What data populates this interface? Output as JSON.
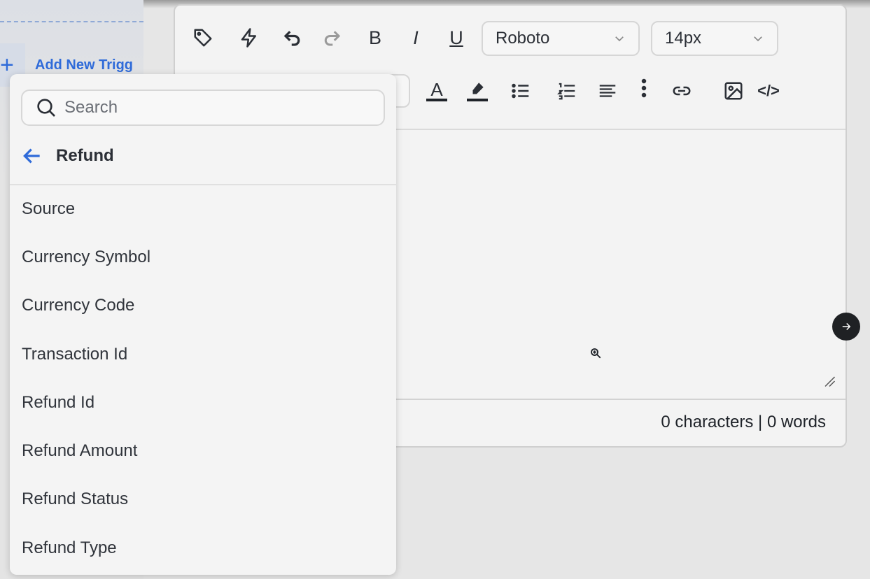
{
  "background": {
    "add_trigger_label": "Add New Trigg",
    "plus_symbol": "+"
  },
  "toolbar": {
    "icons": [
      "tag-icon",
      "bolt-icon",
      "undo-icon",
      "redo-icon",
      "bold-icon",
      "italic-icon",
      "underline-icon",
      "text-color-icon",
      "highlight-icon",
      "bullet-list-icon",
      "numbered-list-icon",
      "align-icon",
      "more-icon",
      "link-icon",
      "image-icon",
      "code-icon"
    ],
    "bold_label": "B",
    "italic_label": "I",
    "underline_label": "U",
    "text_color_label": "A",
    "font_family": "Roboto",
    "font_size": "14px",
    "code_label": "</>"
  },
  "editor": {
    "counter": "0 characters | 0 words"
  },
  "dropdown": {
    "search_placeholder": "Search",
    "back_label": "Refund",
    "options": [
      "Source",
      "Currency Symbol",
      "Currency Code",
      "Transaction Id",
      "Refund Id",
      "Refund Amount",
      "Refund Status",
      "Refund Type"
    ]
  },
  "colors": {
    "accent": "#2f6bd9",
    "panel": "#f4f4f4",
    "fab": "#1f2124"
  }
}
